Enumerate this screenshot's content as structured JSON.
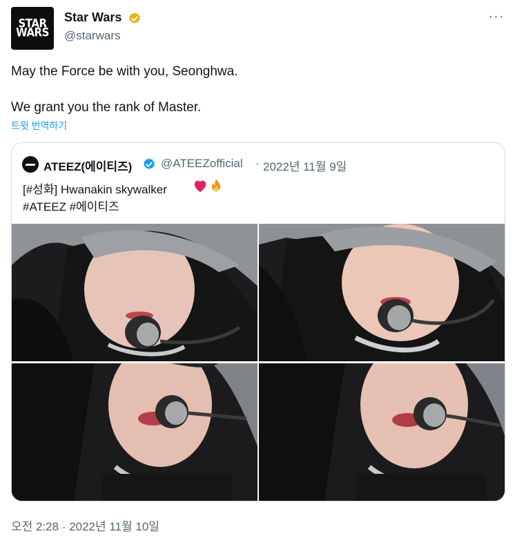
{
  "author": {
    "name": "Star Wars",
    "handle": "@starwars",
    "avatar_text_line1": "STAR",
    "avatar_text_line2": "WARS",
    "verified_color": "#e2b719"
  },
  "more_icon": "more-horizontal-icon",
  "more_label": "···",
  "tweet": {
    "line1": "May the Force be with you, Seonghwa.",
    "line2": "We grant you the rank of Master.",
    "translate_label": "트윗 번역하기",
    "timestamp": "오전 2:28 · 2022년 11월 10일"
  },
  "quoted": {
    "name": "ATEEZ(에이티즈)",
    "handle": "@ATEEZofficial",
    "separator": "·",
    "date": "2022년 11월 9일",
    "line1": "[#성화] Hwanakin skywalker",
    "line2": "#ATEEZ #에이티즈",
    "verified_color": "#1d9bf0"
  },
  "colors": {
    "text": "#0f1419",
    "secondary": "#536471",
    "link": "#1d9bf0",
    "border": "#cfd9de"
  }
}
